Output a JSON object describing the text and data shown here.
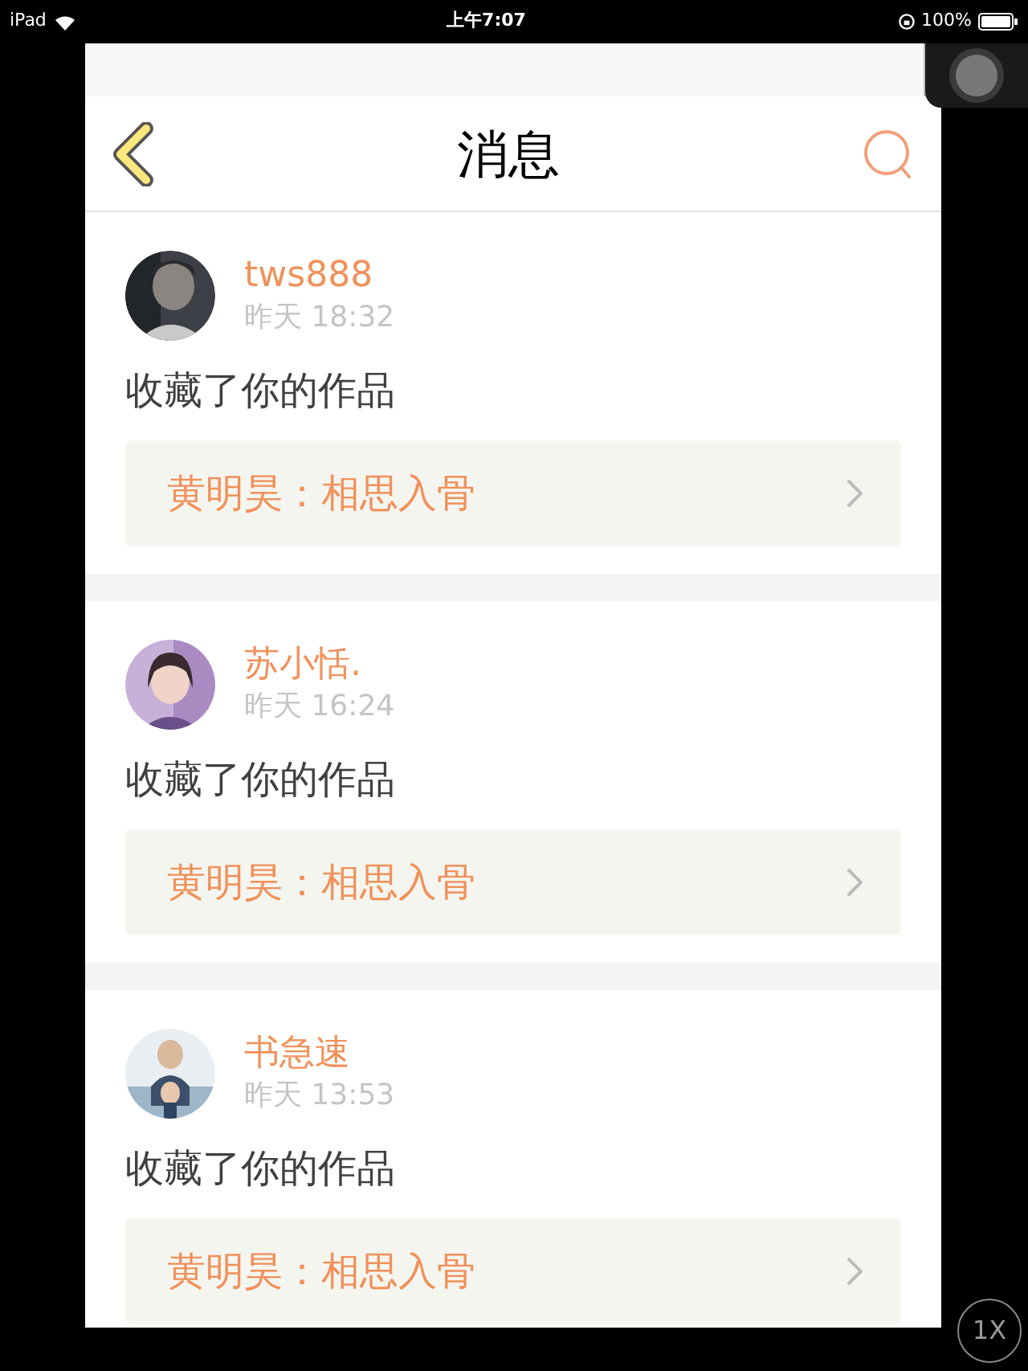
{
  "status_bar": {
    "device": "iPad",
    "time": "上午7:07",
    "battery": "100%"
  },
  "nav": {
    "title": "消息"
  },
  "messages": [
    {
      "user": "tws888",
      "time": "昨天 18:32",
      "action": "收藏了你的作品",
      "work": "黄明昊：相思入骨"
    },
    {
      "user": "苏小恬.",
      "time": "昨天 16:24",
      "action": "收藏了你的作品",
      "work": "黄明昊：相思入骨"
    },
    {
      "user": "书急速",
      "time": "昨天 13:53",
      "action": "收藏了你的作品",
      "work": "黄明昊：相思入骨"
    }
  ],
  "zoom_button": {
    "label": "1X"
  }
}
